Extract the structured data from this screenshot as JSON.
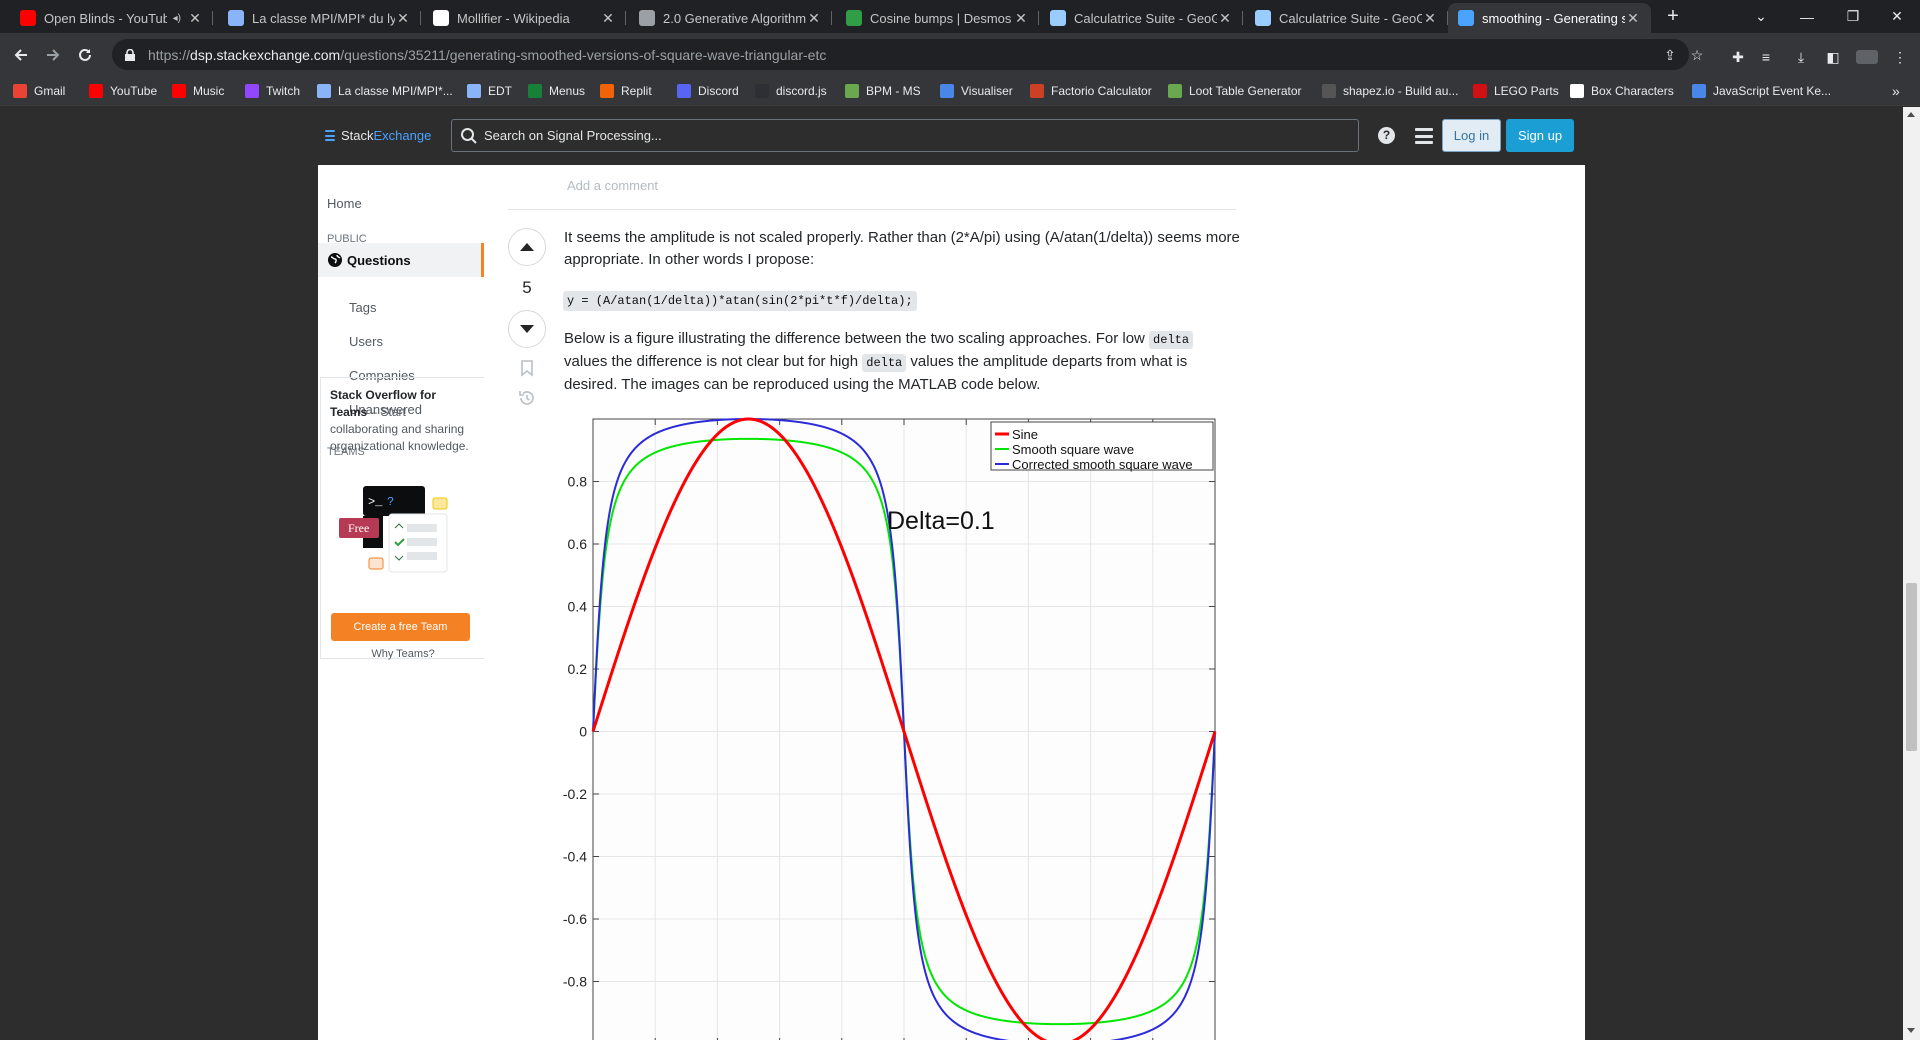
{
  "tabs": [
    {
      "label": "Open Blinds - YouTube",
      "icon": "youtube-icon",
      "color": "#ff0000",
      "audio": true
    },
    {
      "label": "La classe MPI/MPI* du lycée",
      "icon": "page-icon",
      "color": "#8ab4f8"
    },
    {
      "label": "Mollifier - Wikipedia",
      "icon": "wikipedia-icon",
      "color": "#ffffff"
    },
    {
      "label": "2.0 Generative Algorithm",
      "icon": "globe-icon",
      "color": "#9aa0a6"
    },
    {
      "label": "Cosine bumps | Desmos",
      "icon": "desmos-icon",
      "color": "#2f9e44"
    },
    {
      "label": "Calculatrice Suite - GeoGebra",
      "icon": "geogebra-icon",
      "color": "#99ccff"
    },
    {
      "label": "Calculatrice Suite - GeoGebra",
      "icon": "geogebra-icon",
      "color": "#99ccff"
    },
    {
      "label": "smoothing - Generating smoothed",
      "icon": "dsp-icon",
      "color": "#4aa3ff",
      "active": true
    }
  ],
  "omnibox": {
    "scheme": "https://",
    "host": "dsp.stackexchange.com",
    "path": "/questions/35211/generating-smoothed-versions-of-square-wave-triangular-etc"
  },
  "bookmarks": [
    {
      "label": "Gmail",
      "color": "#ea4335"
    },
    {
      "label": "YouTube",
      "color": "#ff0000"
    },
    {
      "label": "Music",
      "color": "#ff0000"
    },
    {
      "label": "Twitch",
      "color": "#9146ff"
    },
    {
      "label": "La classe MPI/MPI*...",
      "color": "#8ab4f8"
    },
    {
      "label": "EDT",
      "color": "#8ab4f8"
    },
    {
      "label": "Menus",
      "color": "#188038"
    },
    {
      "label": "Replit",
      "color": "#f26207"
    },
    {
      "label": "Discord",
      "color": "#5865f2"
    },
    {
      "label": "discord.js",
      "color": "#2c2f33"
    },
    {
      "label": "BPM - MS",
      "color": "#6aa84f"
    },
    {
      "label": "Visualiser",
      "color": "#4a86e8"
    },
    {
      "label": "Factorio Calculator",
      "color": "#cc4125"
    },
    {
      "label": "Loot Table Generator",
      "color": "#6aa84f"
    },
    {
      "label": "shapez.io - Build au...",
      "color": "#555555"
    },
    {
      "label": "LEGO Parts",
      "color": "#d01012"
    },
    {
      "label": "Box Characters",
      "color": "#ffffff"
    },
    {
      "label": "JavaScript Event Ke...",
      "color": "#4a86e8"
    }
  ],
  "site": {
    "logo_stack": "Stack",
    "logo_exchange": "Exchange",
    "search_placeholder": "Search on Signal Processing...",
    "help": "?",
    "login": "Log in",
    "signup": "Sign up"
  },
  "nav": {
    "home": "Home",
    "public": "PUBLIC",
    "questions": "Questions",
    "tags": "Tags",
    "users": "Users",
    "companies": "Companies",
    "unanswered": "Unanswered",
    "teams": "TEAMS",
    "teams_title": "Stack Overflow for Teams",
    "teams_desc": " – Start collaborating and sharing organizational knowledge.",
    "free_badge": "Free",
    "create_team": "Create a free Team",
    "why_teams": "Why Teams?"
  },
  "answer": {
    "add_comment": "Add a comment",
    "votes": "5",
    "p1": "It seems the amplitude is not scaled properly. Rather than (2*A/pi) using (A/atan(1/delta)) seems more appropriate. In other words I propose:",
    "code": "y = (A/atan(1/delta))*atan(sin(2*pi*t*f)/delta);",
    "p2_a": "Below is a figure illustrating the difference between the two scaling approaches. For low ",
    "p2_code1": "delta",
    "p2_b": " values the difference is not clear but for high ",
    "p2_code2": "delta",
    "p2_c": " values the amplitude departs from what is desired. The images can be reproduced using the MATLAB code below."
  },
  "chart_data": {
    "type": "line",
    "title": "",
    "annotation": "Delta=0.1",
    "xlabel": "",
    "ylabel": "",
    "xlim": [
      0,
      1
    ],
    "ylim": [
      -1,
      1
    ],
    "yticks": [
      -0.8,
      -0.6,
      -0.4,
      -0.2,
      0,
      0.2,
      0.4,
      0.6,
      0.8
    ],
    "yticklabels": [
      "-0.8",
      "-0.6",
      "-0.4",
      "-0.2",
      "0",
      "0.2",
      "0.4",
      "0.6",
      "0.8"
    ],
    "grid": true,
    "legend": "top-right",
    "delta": 0.1,
    "series": [
      {
        "name": "Sine",
        "color": "#ff0000",
        "kind": "sine",
        "amplitude": 1
      },
      {
        "name": "Smooth square wave",
        "color": "#00e600",
        "kind": "square_2A_over_pi",
        "amplitude": 0.937
      },
      {
        "name": "Corrected smooth square wave",
        "color": "#2b2bd9",
        "kind": "square_atan_scaled",
        "amplitude": 1
      }
    ]
  }
}
